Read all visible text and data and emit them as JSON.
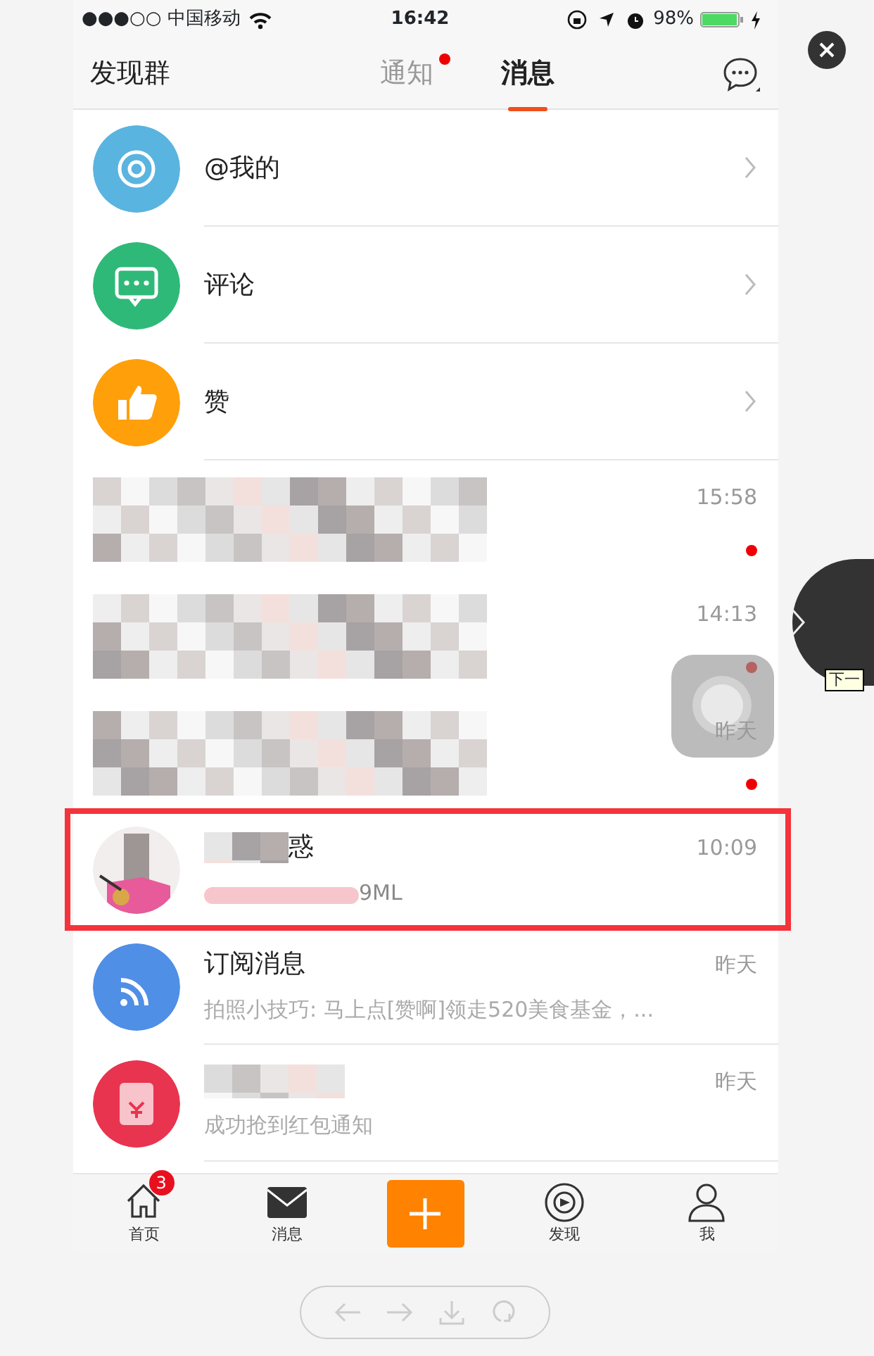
{
  "status_bar": {
    "carrier": "●●●○○ 中国移动",
    "time": "16:42",
    "battery": "98%"
  },
  "header": {
    "title": "发现群",
    "tabs": [
      {
        "label": "通知",
        "selected": false,
        "dot": true
      },
      {
        "label": "消息",
        "selected": true,
        "dot": false
      }
    ]
  },
  "notifications": [
    {
      "kind": "at",
      "label": "@我的",
      "color": "#5ab4e0"
    },
    {
      "kind": "comment",
      "label": "评论",
      "color": "#2fb979"
    },
    {
      "kind": "like",
      "label": "赞",
      "color": "#ff9f0a"
    }
  ],
  "messages": [
    {
      "kind": "blurred",
      "time": "15:58",
      "unread": true
    },
    {
      "kind": "blurred",
      "time": "14:13",
      "unread": true
    },
    {
      "kind": "blurred",
      "time": "昨天",
      "unread": true
    },
    {
      "kind": "person",
      "title": "惑",
      "preview": "9ML",
      "time": "10:09",
      "unread": false,
      "highlighted": true
    },
    {
      "kind": "subscription",
      "title": "订阅消息",
      "preview": "拍照小技巧: 马上点[赞啊]领走520美食基金，...",
      "time": "昨天",
      "unread": false,
      "color": "#4f8fe6"
    },
    {
      "kind": "redpacket",
      "preview": "成功抢到红包通知",
      "time": "昨天",
      "unread": false,
      "color": "#e8344e"
    }
  ],
  "tab_bar": [
    {
      "kind": "home",
      "label": "首页",
      "badge": "3"
    },
    {
      "kind": "mail",
      "label": "消息"
    },
    {
      "kind": "plus"
    },
    {
      "kind": "discover",
      "label": "发现"
    },
    {
      "kind": "me",
      "label": "我"
    }
  ],
  "viewer": {
    "tooltip": "下一"
  }
}
